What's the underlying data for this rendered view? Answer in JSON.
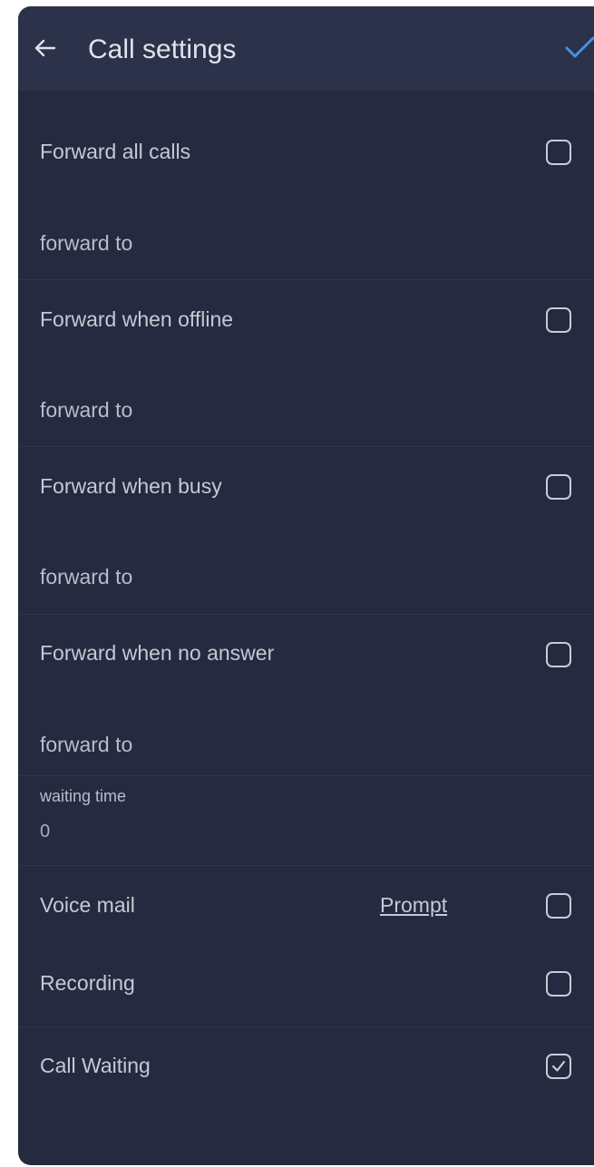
{
  "header": {
    "title": "Call settings",
    "back_icon": "arrow-left-icon",
    "confirm_icon": "checkmark-icon",
    "accent_color": "#4a90e2"
  },
  "forward_all": {
    "label": "Forward all calls",
    "checked": false,
    "field_label": "forward to"
  },
  "forward_offline": {
    "label": "Forward when offline",
    "checked": false,
    "field_label": "forward to"
  },
  "forward_busy": {
    "label": "Forward when busy",
    "checked": false,
    "field_label": "forward to"
  },
  "forward_no_answer": {
    "label": "Forward when no answer",
    "checked": false,
    "field_label": "forward to"
  },
  "waiting_time": {
    "label": "waiting time",
    "value": "0"
  },
  "voice_mail": {
    "label": "Voice mail",
    "link": "Prompt",
    "checked": false
  },
  "recording": {
    "label": "Recording",
    "checked": false
  },
  "call_waiting": {
    "label": "Call Waiting",
    "checked": true
  }
}
